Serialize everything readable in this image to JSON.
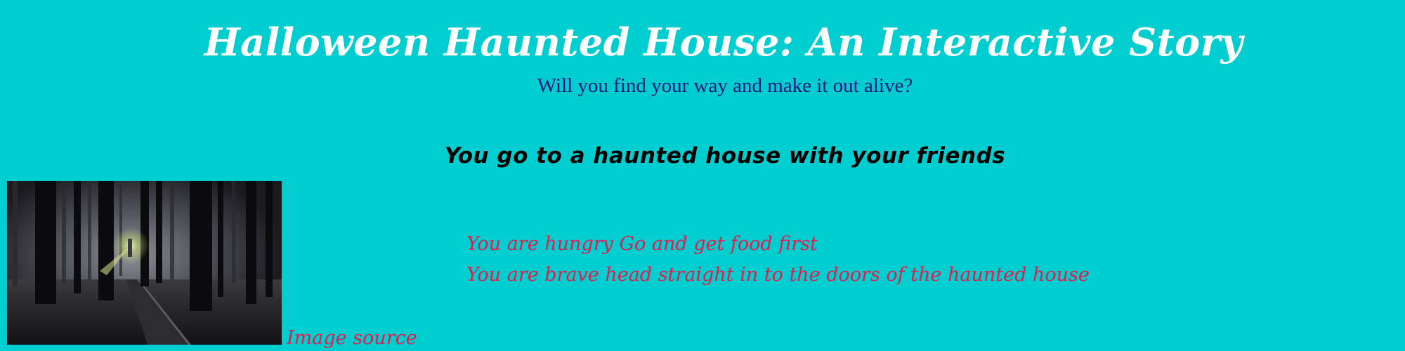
{
  "page": {
    "title": "Halloween Haunted House: An Interactive Story",
    "subtitle": "Will you find your way and make it out alive?",
    "scene_heading": "You go to a haunted house with your friends"
  },
  "scene_image": {
    "description": "dark-foggy-forest-path-with-glowing-lantern"
  },
  "choices": [
    {
      "label": "You are hungry Go and get food first"
    },
    {
      "label": "You are brave head straight in to the doors of the haunted house"
    }
  ],
  "image_source": {
    "label": "Image source"
  },
  "colors": {
    "background": "#00cdcf",
    "title": "#ffffff",
    "subtitle": "#1a1a7a",
    "heading": "#000000",
    "link": "#e0204c"
  }
}
